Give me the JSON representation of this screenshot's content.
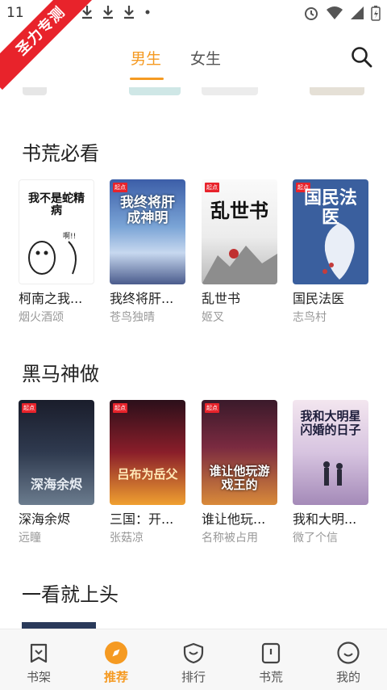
{
  "status_bar": {
    "time": "11"
  },
  "ribbon": {
    "text": "圣力专测"
  },
  "tabs": [
    {
      "label": "男生"
    },
    {
      "label": "女生"
    }
  ],
  "accent_color": "#f59a22",
  "sections": [
    {
      "title": "书荒必看",
      "books": [
        {
          "title": "柯南之我...",
          "author": "烟火酒颂",
          "cover_text": "我不是蛇精病"
        },
        {
          "title": "我终将肝...",
          "author": "苍鸟独晴",
          "cover_text": "我终将肝成神明"
        },
        {
          "title": "乱世书",
          "author": "姬叉",
          "cover_text": "乱世书"
        },
        {
          "title": "国民法医",
          "author": "志鸟村",
          "cover_text": "国民法医"
        }
      ]
    },
    {
      "title": "黑马神做",
      "books": [
        {
          "title": "深海余烬",
          "author": "远瞳",
          "cover_text": "深海余烬"
        },
        {
          "title": "三国：开...",
          "author": "张菇凉",
          "cover_text": "吕布为岳父"
        },
        {
          "title": "谁让他玩...",
          "author": "名称被占用",
          "cover_text": "谁让他玩游戏王的"
        },
        {
          "title": "我和大明...",
          "author": "微了个信",
          "cover_text": "我和大明星闪婚的日子"
        }
      ]
    },
    {
      "title": "一看就上头",
      "books": []
    }
  ],
  "bottom_nav": [
    {
      "label": "书架",
      "icon": "bookshelf-icon"
    },
    {
      "label": "推荐",
      "icon": "compass-icon",
      "active": true
    },
    {
      "label": "排行",
      "icon": "ranking-icon"
    },
    {
      "label": "书荒",
      "icon": "book-icon"
    },
    {
      "label": "我的",
      "icon": "profile-icon"
    }
  ]
}
